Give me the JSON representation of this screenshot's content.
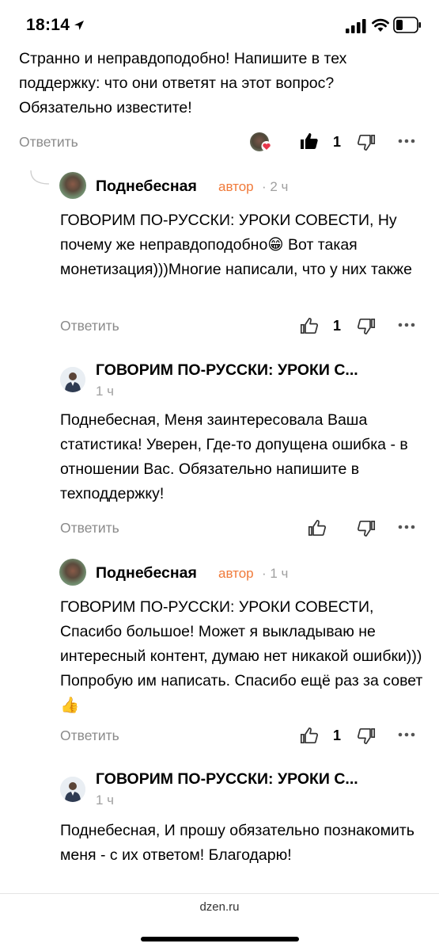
{
  "status_bar": {
    "time": "18:14"
  },
  "top_comment": {
    "text": "Странно и неправдоподобно! Напишите в тех поддержку: что они ответят на этот вопрос? Обязательно известите!",
    "reply_label": "Ответить",
    "likes": "1"
  },
  "replies": [
    {
      "author": "Поднебесная",
      "badge": "автор",
      "time": "· 2 ч",
      "text": "ГОВОРИМ ПО-РУССКИ: УРОКИ СОВЕСТИ, Ну почему же неправдоподобно😁 Вот такая монетизация)))Многие написали, что у них также",
      "reply_label": "Ответить",
      "likes": "1"
    },
    {
      "author": "ГОВОРИМ ПО-РУССКИ: УРОКИ С...",
      "time": "1 ч",
      "text": "Поднебесная, Меня заинтересовала Ваша статистика! Уверен, Где-то допущена ошибка - в отношении Вас. Обязательно напишите в техподдержку!",
      "reply_label": "Ответить"
    },
    {
      "author": "Поднебесная",
      "badge": "автор",
      "time": "· 1 ч",
      "text": "ГОВОРИМ ПО-РУССКИ: УРОКИ СОВЕСТИ, Спасибо большое! Может я выкладываю не интересный контент, думаю нет никакой ошибки))) Попробую им написать. Спасибо ещё раз за совет👍",
      "reply_label": "Ответить",
      "likes": "1"
    },
    {
      "author": "ГОВОРИМ ПО-РУССКИ: УРОКИ С...",
      "time": "1 ч",
      "text": "Поднебесная, И прошу обязательно познакомить меня - с их ответом! Благодарю!"
    }
  ],
  "footer": {
    "url": "dzen.ru"
  },
  "colors": {
    "author_badge": "#f07a3a",
    "muted": "#8a8a8a"
  }
}
